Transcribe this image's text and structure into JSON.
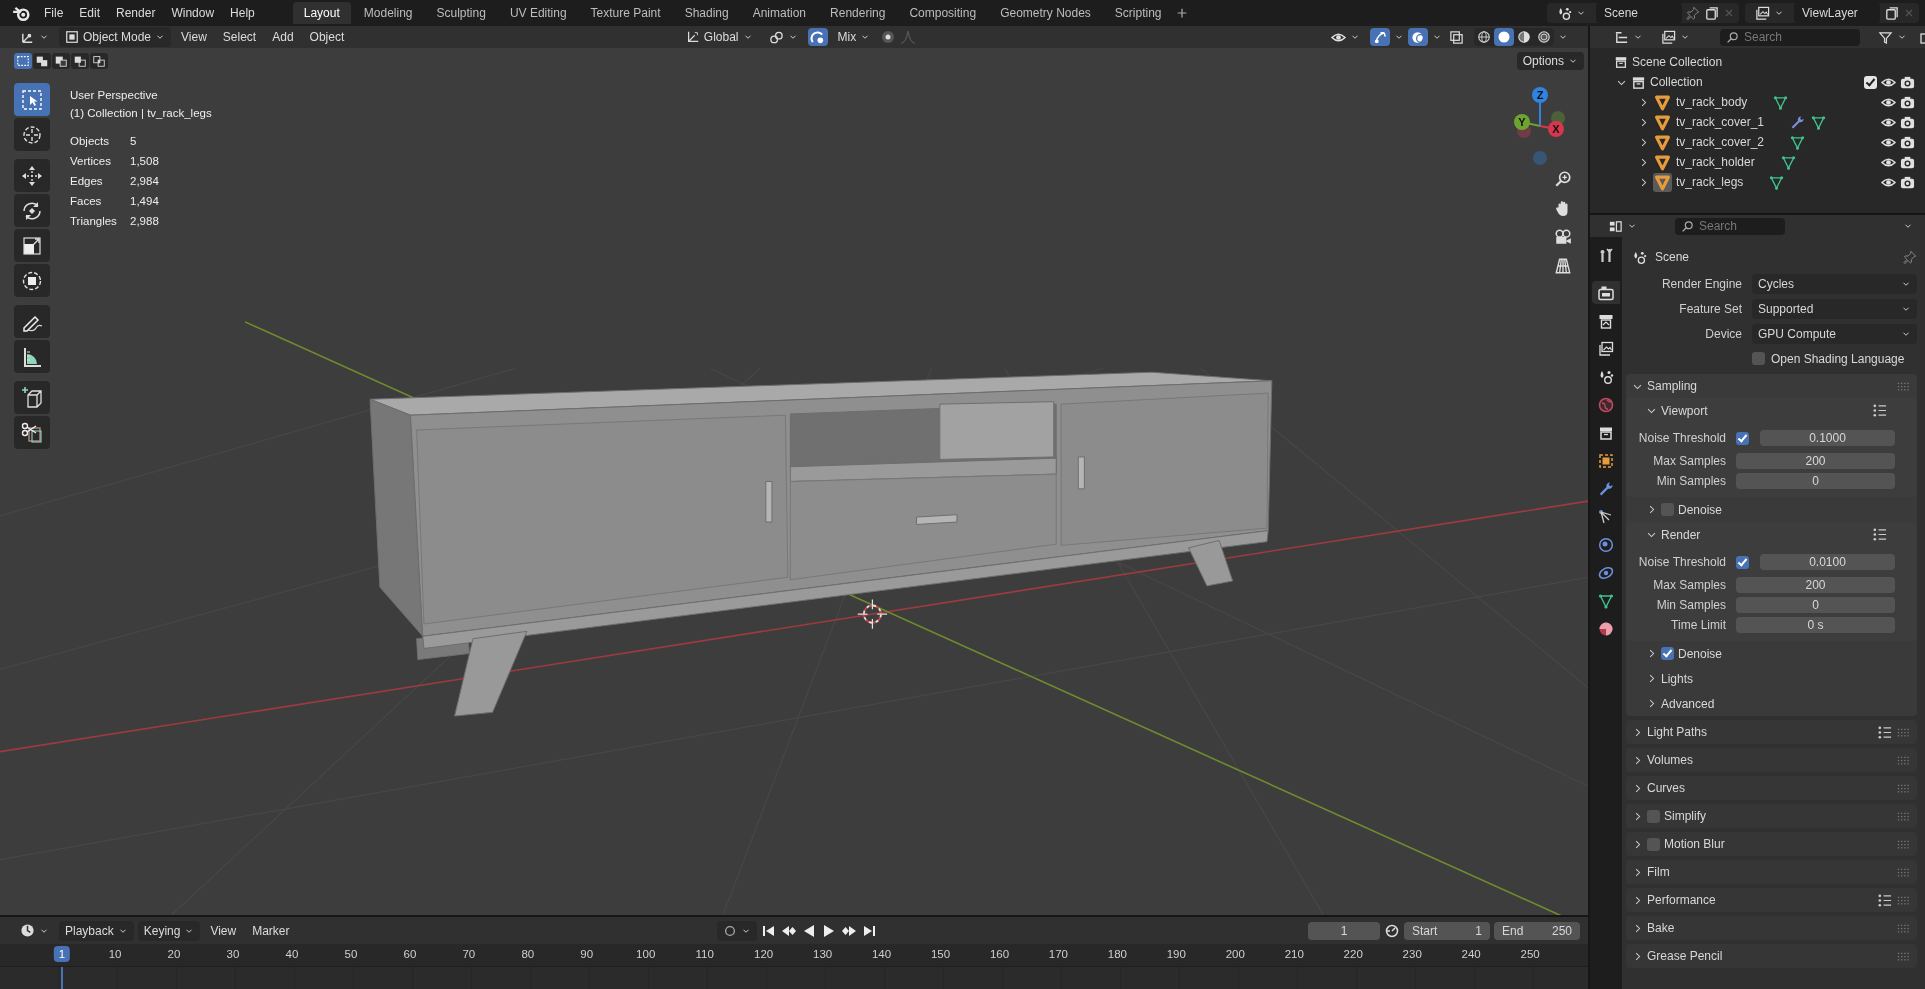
{
  "menu": [
    "File",
    "Edit",
    "Render",
    "Window",
    "Help"
  ],
  "workspaces": [
    {
      "label": "Layout",
      "selected": true
    },
    {
      "label": "Modeling",
      "selected": false
    },
    {
      "label": "Sculpting",
      "selected": false
    },
    {
      "label": "UV Editing",
      "selected": false
    },
    {
      "label": "Texture Paint",
      "selected": false
    },
    {
      "label": "Shading",
      "selected": false
    },
    {
      "label": "Animation",
      "selected": false
    },
    {
      "label": "Rendering",
      "selected": false
    },
    {
      "label": "Compositing",
      "selected": false
    },
    {
      "label": "Geometry Nodes",
      "selected": false
    },
    {
      "label": "Scripting",
      "selected": false
    }
  ],
  "scene": {
    "value": "Scene"
  },
  "view_layer": {
    "value": "ViewLayer"
  },
  "viewport": {
    "mode": "Object Mode",
    "menus": [
      "View",
      "Select",
      "Add",
      "Object"
    ],
    "orientation": "Global",
    "snap_target": "Mix",
    "toggles": {
      "snap": true,
      "gizmos": true,
      "overlays": true,
      "xray": false
    },
    "shading": [
      {
        "kind": "wireframe",
        "selected": false
      },
      {
        "kind": "solid",
        "selected": true
      },
      {
        "kind": "material",
        "selected": false
      },
      {
        "kind": "rendered",
        "selected": false
      }
    ],
    "select_modes": [
      {
        "kind": "set",
        "selected": true
      },
      {
        "kind": "extend",
        "selected": false
      },
      {
        "kind": "subtract",
        "selected": false
      },
      {
        "kind": "invert",
        "selected": false
      },
      {
        "kind": "intersect",
        "selected": false
      }
    ],
    "options": "Options",
    "view_name": "User Perspective",
    "collection_info": "(1) Collection | tv_rack_legs",
    "stats": [
      {
        "label": "Objects",
        "value": "5"
      },
      {
        "label": "Vertices",
        "value": "1,508"
      },
      {
        "label": "Edges",
        "value": "2,984"
      },
      {
        "label": "Faces",
        "value": "1,494"
      },
      {
        "label": "Triangles",
        "value": "2,988"
      }
    ],
    "toolbar": [
      {
        "kind": "select",
        "selected": true
      },
      {
        "kind": "cursor",
        "selected": false
      },
      {
        "kind": "move",
        "selected": false
      },
      {
        "kind": "rotate",
        "selected": false
      },
      {
        "kind": "scale",
        "selected": false
      },
      {
        "kind": "transform",
        "selected": false
      },
      {
        "kind": "annotate",
        "selected": false
      },
      {
        "kind": "measure",
        "selected": false
      },
      {
        "kind": "add_cube",
        "selected": false
      },
      {
        "kind": "cut",
        "selected": false
      }
    ],
    "gizmo": [
      {
        "label": "Z",
        "color": "#2f83e3"
      },
      {
        "label": "Y",
        "color": "#6ea331"
      },
      {
        "label": "X",
        "color": "#d6374f"
      }
    ]
  },
  "outliner": {
    "search": {
      "placeholder": "Search"
    },
    "root": "Scene Collection",
    "collections": [
      {
        "name": "Collection",
        "expanded": true,
        "checked": true,
        "children": [
          {
            "name": "tv_rack_body",
            "expanded": false,
            "active": false,
            "modifier": false
          },
          {
            "name": "tv_rack_cover_1",
            "expanded": false,
            "active": false,
            "modifier": true
          },
          {
            "name": "tv_rack_cover_2",
            "expanded": false,
            "active": false,
            "modifier": false
          },
          {
            "name": "tv_rack_holder",
            "expanded": false,
            "active": false,
            "modifier": false
          },
          {
            "name": "tv_rack_legs",
            "expanded": false,
            "active": true,
            "modifier": false
          }
        ]
      }
    ]
  },
  "properties": {
    "search": {
      "placeholder": "Search"
    },
    "tabs": [
      {
        "kind": "tool",
        "selected": false
      },
      {
        "kind": "render",
        "selected": true
      },
      {
        "kind": "output",
        "selected": false
      },
      {
        "kind": "view_layer",
        "selected": false
      },
      {
        "kind": "scene",
        "selected": false
      },
      {
        "kind": "world",
        "selected": false
      },
      {
        "kind": "collection",
        "selected": false
      },
      {
        "kind": "object",
        "selected": false
      },
      {
        "kind": "modifiers",
        "selected": false
      },
      {
        "kind": "particles",
        "selected": false
      },
      {
        "kind": "physics",
        "selected": false
      },
      {
        "kind": "constraints",
        "selected": false
      },
      {
        "kind": "data",
        "selected": false
      },
      {
        "kind": "material",
        "selected": false
      }
    ],
    "context": "Scene",
    "fields": [
      {
        "kind": "dropdown",
        "label": "Render Engine",
        "value": "Cycles"
      },
      {
        "kind": "dropdown",
        "label": "Feature Set",
        "value": "Supported"
      },
      {
        "kind": "dropdown",
        "label": "Device",
        "value": "GPU Compute"
      },
      {
        "kind": "checkbox",
        "label": "Open Shading Language",
        "checked": false
      }
    ],
    "panels": [
      {
        "label": "Sampling",
        "expanded": true,
        "presets": false,
        "children": [
          {
            "kind": "subpanel",
            "label": "Viewport",
            "expanded": true,
            "presets": true,
            "children": [
              {
                "kind": "threshold",
                "label": "Noise Threshold",
                "checked": true,
                "value": "0.1000"
              },
              {
                "kind": "number",
                "label": "Max Samples",
                "value": "200"
              },
              {
                "kind": "number",
                "label": "Min Samples",
                "value": "0"
              }
            ]
          },
          {
            "kind": "subpanel",
            "label": "Denoise",
            "expanded": false,
            "presets": false,
            "checked": false
          },
          {
            "kind": "subpanel",
            "label": "Render",
            "expanded": true,
            "presets": true,
            "children": [
              {
                "kind": "threshold",
                "label": "Noise Threshold",
                "checked": true,
                "value": "0.0100"
              },
              {
                "kind": "number",
                "label": "Max Samples",
                "value": "200"
              },
              {
                "kind": "number",
                "label": "Min Samples",
                "value": "0"
              },
              {
                "kind": "number",
                "label": "Time Limit",
                "value": "0 s"
              }
            ]
          },
          {
            "kind": "subpanel",
            "label": "Denoise",
            "expanded": false,
            "presets": false,
            "checked": true
          },
          {
            "kind": "subpanel",
            "label": "Lights",
            "expanded": false,
            "presets": false
          },
          {
            "kind": "subpanel",
            "label": "Advanced",
            "expanded": false,
            "presets": false
          }
        ]
      },
      {
        "label": "Light Paths",
        "expanded": false,
        "presets": true
      },
      {
        "label": "Volumes",
        "expanded": false,
        "presets": false
      },
      {
        "label": "Curves",
        "expanded": false,
        "presets": false
      },
      {
        "label": "Simplify",
        "expanded": false,
        "presets": false,
        "checked": false
      },
      {
        "label": "Motion Blur",
        "expanded": false,
        "presets": false,
        "checked": false
      },
      {
        "label": "Film",
        "expanded": false,
        "presets": false
      },
      {
        "label": "Performance",
        "expanded": false,
        "presets": true
      },
      {
        "label": "Bake",
        "expanded": false,
        "presets": false
      },
      {
        "label": "Grease Pencil",
        "expanded": false,
        "presets": false
      }
    ]
  },
  "timeline": {
    "menus": [
      {
        "label": "Playback",
        "dropdown": true
      },
      {
        "label": "Keying",
        "dropdown": true
      },
      {
        "label": "View",
        "dropdown": false
      },
      {
        "label": "Marker",
        "dropdown": false
      }
    ],
    "current_frame": "1",
    "start": {
      "label": "Start",
      "value": "1"
    },
    "end": {
      "label": "End",
      "value": "250"
    },
    "playhead": "1",
    "ruler": [
      "10",
      "20",
      "30",
      "40",
      "50",
      "60",
      "70",
      "80",
      "90",
      "100",
      "110",
      "120",
      "130",
      "140",
      "150",
      "160",
      "170",
      "180",
      "190",
      "200",
      "210",
      "220",
      "230",
      "240",
      "250"
    ]
  }
}
